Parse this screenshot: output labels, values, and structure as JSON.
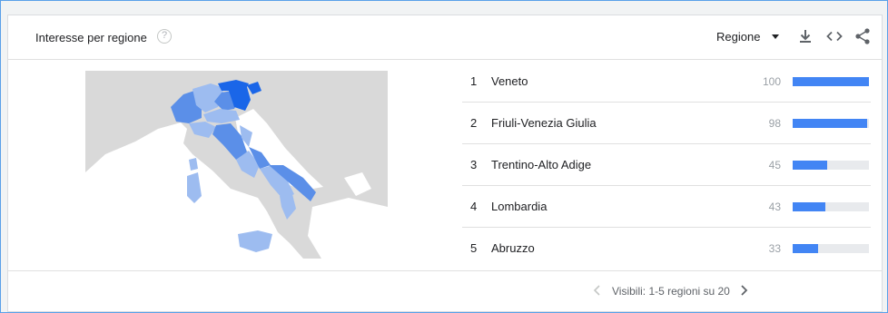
{
  "widget": {
    "title": "Interesse per regione",
    "help_icon": "help-circle-icon",
    "region_select_label": "Regione",
    "actions": [
      "dropdown-caret-icon",
      "download-icon",
      "embed-icon",
      "share-icon"
    ]
  },
  "regions": [
    {
      "rank": "1",
      "name": "Veneto",
      "value": "100",
      "level": 100
    },
    {
      "rank": "2",
      "name": "Friuli-Venezia Giulia",
      "value": "98",
      "level": 98
    },
    {
      "rank": "3",
      "name": "Trentino-Alto Adige",
      "value": "45",
      "level": 45
    },
    {
      "rank": "4",
      "name": "Lombardia",
      "value": "43",
      "level": 43
    },
    {
      "rank": "5",
      "name": "Abruzzo",
      "value": "33",
      "level": 33
    }
  ],
  "pagination": {
    "text": "Visibili: 1-5 regioni su 20",
    "prev_icon": "chevron-left-icon",
    "next_icon": "chevron-right-icon"
  },
  "colors": {
    "bar": "#4285f4",
    "map_dark": "#1a66e8",
    "map_mid": "#5b8fe8",
    "map_light": "#9dbcf0",
    "land": "#d9d9d9",
    "sea": "#ffffff"
  }
}
